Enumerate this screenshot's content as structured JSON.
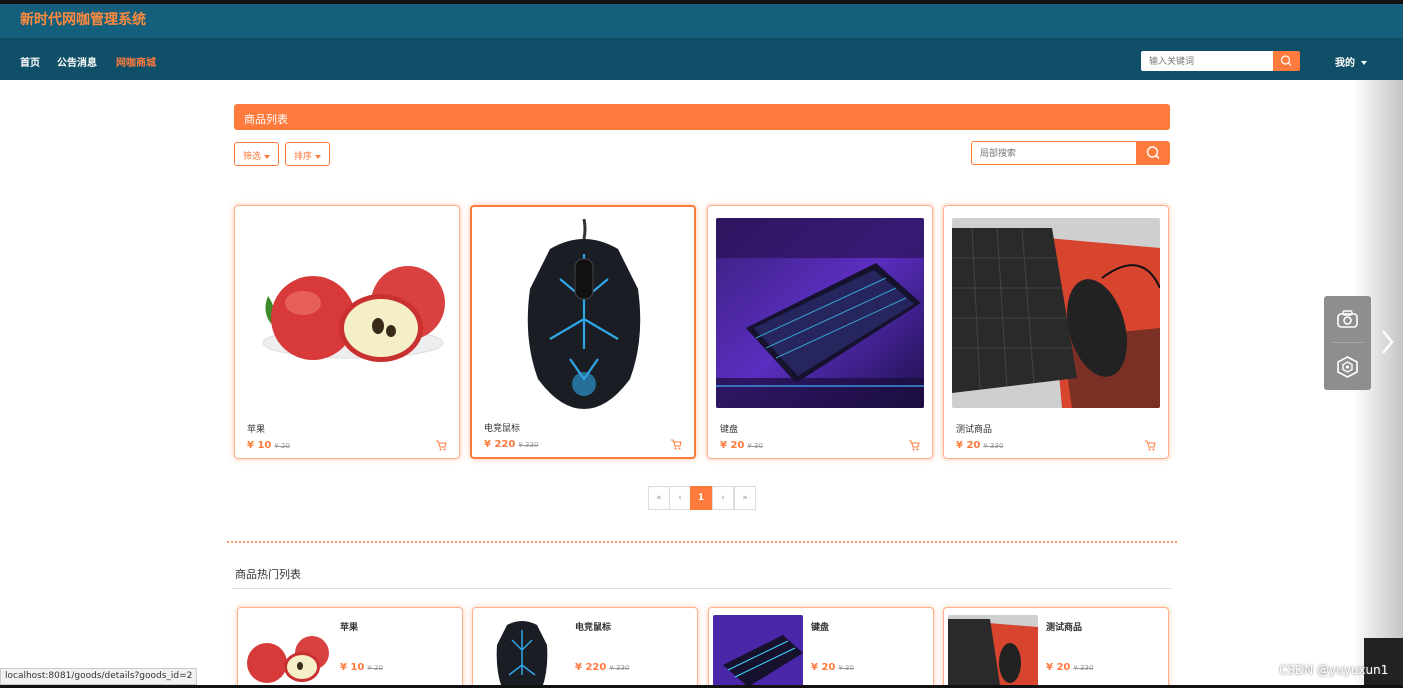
{
  "app": {
    "title": "新时代网咖管理系统"
  },
  "nav": {
    "items": [
      "首页",
      "公告消息",
      "网咖商城"
    ],
    "active": "网咖商城",
    "search_placeholder": "输入关键词",
    "me": "我的"
  },
  "mall": {
    "section_title": "商品列表",
    "filter_label": "筛选",
    "sort_label": "排序",
    "local_search_placeholder": "局部搜索"
  },
  "products": [
    {
      "name": "苹果",
      "price": "¥ 10",
      "old_price": "¥ 20",
      "image": "apple"
    },
    {
      "name": "电竞鼠标",
      "price": "¥ 220",
      "old_price": "¥ 330",
      "image": "gaming-mouse"
    },
    {
      "name": "键盘",
      "price": "¥ 20",
      "old_price": "¥ 30",
      "image": "keyboard"
    },
    {
      "name": "测试商品",
      "price": "¥ 20",
      "old_price": "¥ 330",
      "image": "keyboard-mouse-pad"
    }
  ],
  "pagination": {
    "first": "«",
    "prev": "‹",
    "current": "1",
    "next": "›",
    "last": "»"
  },
  "hot": {
    "title": "商品热门列表"
  },
  "status_url": "localhost:8081/goods/details?goods_id=2",
  "watermark": "CSDN @yuyuxun1",
  "colors": {
    "accent": "#ff7a3d",
    "header": "#145f7c",
    "navbar": "#0f4f67"
  }
}
